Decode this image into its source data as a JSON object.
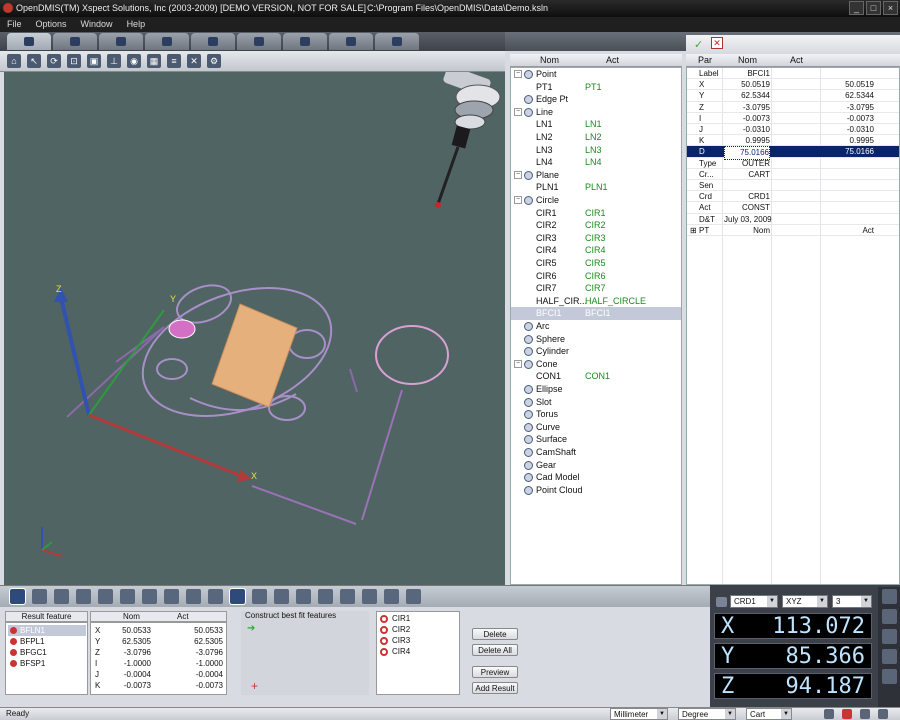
{
  "window": {
    "title": "OpenDMIS(TM) Xspect Solutions, Inc  (2003-2009) [DEMO VERSION, NOT FOR SALE]",
    "path": "C:\\Program Files\\OpenDMIS\\Data\\Demo.ksln",
    "controls": [
      "_",
      "□",
      "×"
    ]
  },
  "menu": [
    "File",
    "Options",
    "Window",
    "Help"
  ],
  "tree": {
    "col_nom": "Nom",
    "col_act": "Act",
    "rows": [
      {
        "type": "cat",
        "name": "Point",
        "open": true
      },
      {
        "type": "item",
        "name": "PT1",
        "act": "PT1"
      },
      {
        "type": "cat",
        "name": "Edge Pt",
        "open": false
      },
      {
        "type": "cat",
        "name": "Line",
        "open": true
      },
      {
        "type": "item",
        "name": "LN1",
        "act": "LN1"
      },
      {
        "type": "item",
        "name": "LN2",
        "act": "LN2"
      },
      {
        "type": "item",
        "name": "LN3",
        "act": "LN3"
      },
      {
        "type": "item",
        "name": "LN4",
        "act": "LN4"
      },
      {
        "type": "cat",
        "name": "Plane",
        "open": true
      },
      {
        "type": "item",
        "name": "PLN1",
        "act": "PLN1"
      },
      {
        "type": "cat",
        "name": "Circle",
        "open": true
      },
      {
        "type": "item",
        "name": "CIR1",
        "act": "CIR1"
      },
      {
        "type": "item",
        "name": "CIR2",
        "act": "CIR2"
      },
      {
        "type": "item",
        "name": "CIR3",
        "act": "CIR3"
      },
      {
        "type": "item",
        "name": "CIR4",
        "act": "CIR4"
      },
      {
        "type": "item",
        "name": "CIR5",
        "act": "CIR5"
      },
      {
        "type": "item",
        "name": "CIR6",
        "act": "CIR6"
      },
      {
        "type": "item",
        "name": "CIR7",
        "act": "CIR7"
      },
      {
        "type": "item",
        "name": "HALF_CIR...",
        "act": "HALF_CIRCLE"
      },
      {
        "type": "item",
        "name": "BFCI1",
        "act": "BFCI1",
        "selected": true
      },
      {
        "type": "cat",
        "name": "Arc",
        "open": false
      },
      {
        "type": "cat",
        "name": "Sphere",
        "open": false
      },
      {
        "type": "cat",
        "name": "Cylinder",
        "open": false
      },
      {
        "type": "cat",
        "name": "Cone",
        "open": true
      },
      {
        "type": "item",
        "name": "CON1",
        "act": "CON1"
      },
      {
        "type": "cat",
        "name": "Ellipse",
        "open": false
      },
      {
        "type": "cat",
        "name": "Slot",
        "open": false
      },
      {
        "type": "cat",
        "name": "Torus",
        "open": false
      },
      {
        "type": "cat",
        "name": "Curve",
        "open": false
      },
      {
        "type": "cat",
        "name": "Surface",
        "open": false
      },
      {
        "type": "cat",
        "name": "CamShaft",
        "open": false
      },
      {
        "type": "cat",
        "name": "Gear",
        "open": false
      },
      {
        "type": "cat",
        "name": "Cad Model",
        "open": false
      },
      {
        "type": "cat",
        "name": "Point Cloud",
        "open": false
      }
    ]
  },
  "props": {
    "col_par": "Par",
    "col_nom": "Nom",
    "col_act": "Act",
    "rows": [
      {
        "k": "Label",
        "n": "BFCI1",
        "a": ""
      },
      {
        "k": "X",
        "n": "50.0519",
        "a": "50.0519"
      },
      {
        "k": "Y",
        "n": "62.5344",
        "a": "62.5344"
      },
      {
        "k": "Z",
        "n": "-3.0795",
        "a": "-3.0795"
      },
      {
        "k": "I",
        "n": "-0.0073",
        "a": "-0.0073"
      },
      {
        "k": "J",
        "n": "-0.0310",
        "a": "-0.0310"
      },
      {
        "k": "K",
        "n": "0.9995",
        "a": "0.9995"
      },
      {
        "k": "D",
        "n": "75.0166",
        "a": "75.0166",
        "selected": true
      },
      {
        "k": "Type",
        "n": "OUTER",
        "a": ""
      },
      {
        "k": "Cr...",
        "n": "CART",
        "a": ""
      },
      {
        "k": "Sen",
        "n": "",
        "a": ""
      },
      {
        "k": "Crd",
        "n": "CRD1",
        "a": ""
      },
      {
        "k": "Act",
        "n": "CONST",
        "a": ""
      },
      {
        "k": "D&T",
        "n": "July 03, 2009",
        "a": ""
      },
      {
        "k": "PT",
        "n": "Nom",
        "a": "Act",
        "expand": true
      }
    ]
  },
  "result_feature": {
    "header": "Result feature",
    "items": [
      {
        "name": "BFLN1",
        "selected": true
      },
      {
        "name": "BFPL1"
      },
      {
        "name": "BFGC1"
      },
      {
        "name": "BFSP1"
      }
    ]
  },
  "result_values": {
    "col_nom": "Nom",
    "col_act": "Act",
    "rows": [
      {
        "k": "X",
        "n": "50.0533",
        "a": "50.0533"
      },
      {
        "k": "Y",
        "n": "62.5305",
        "a": "62.5305"
      },
      {
        "k": "Z",
        "n": "-3.0796",
        "a": "-3.0796"
      },
      {
        "k": "I",
        "n": "-1.0000",
        "a": "-1.0000"
      },
      {
        "k": "J",
        "n": "-0.0004",
        "a": "-0.0004"
      },
      {
        "k": "K",
        "n": "-0.0073",
        "a": "-0.0073"
      }
    ]
  },
  "construct": {
    "label": "Construct best fit features",
    "features": [
      "CIR1",
      "CIR2",
      "CIR3",
      "CIR4"
    ]
  },
  "buttons": {
    "delete": "Delete",
    "delete_all": "Delete All",
    "preview": "Preview",
    "add_result": "Add Result"
  },
  "dro": {
    "crd": "CRD1",
    "plane": "XYZ",
    "count": "3",
    "x_label": "X",
    "x": "113.072",
    "y_label": "Y",
    "y": "85.366",
    "z_label": "Z",
    "z": "94.187"
  },
  "status": {
    "text": "Ready",
    "unit": "Millimeter",
    "angle": "Degree",
    "coord": "Cart"
  },
  "viewport": {
    "axis_z": "Z",
    "axis_y": "Y",
    "axis_x": "X",
    "colors": {
      "bg": "#4f6463",
      "feature": "#a88fc8",
      "plate": "#e6b07c",
      "x_axis": "#b23a3a",
      "y_axis": "#2f9a3f",
      "z_axis": "#3252b0",
      "highlight": "#d36fc4"
    }
  }
}
